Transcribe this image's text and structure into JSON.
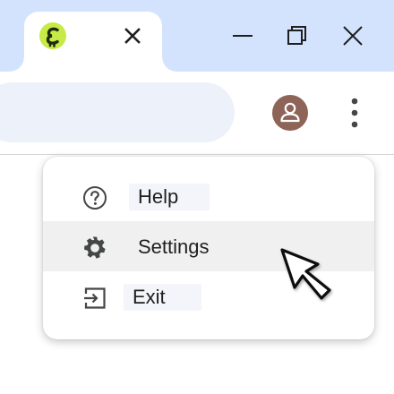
{
  "tab": {
    "favicon_icon": "app-logo-icon",
    "close_icon": "close-icon"
  },
  "window_controls": {
    "minimize_icon": "minimize-icon",
    "restore_icon": "restore-icon",
    "close_icon": "close-icon"
  },
  "toolbar": {
    "avatar_icon": "person-icon",
    "menu_icon": "more-vert-icon"
  },
  "menu": {
    "items": [
      {
        "label": "Help",
        "icon": "help-icon"
      },
      {
        "label": "Settings",
        "icon": "gear-icon"
      },
      {
        "label": "Exit",
        "icon": "exit-icon"
      }
    ],
    "hovered_item": "Settings"
  },
  "colors": {
    "titlebar": "#d3e3fd",
    "omnibox": "#edf2fa",
    "avatar": "#8d6457",
    "favicon": "#c7ea46",
    "hover": "#f0f0f0"
  }
}
